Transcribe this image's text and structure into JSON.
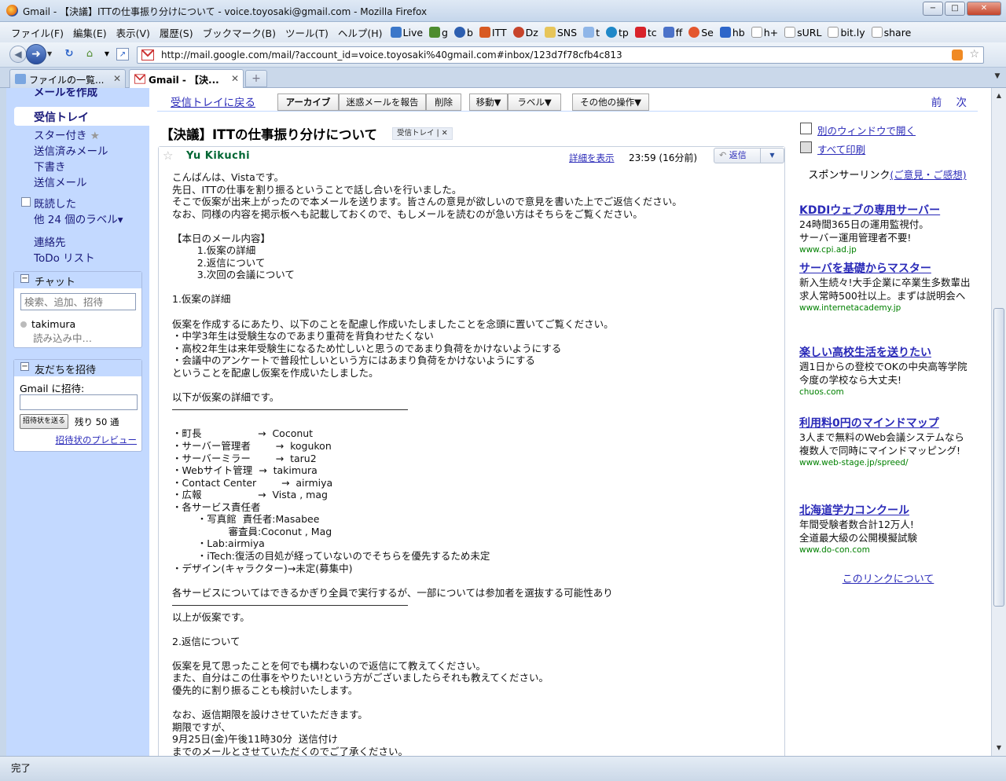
{
  "window": {
    "title": "Gmail - 【決議】ITTの仕事振り分けについて - voice.toyosaki@gmail.com - Mozilla Firefox",
    "min_glyph": "−",
    "max_glyph": "□",
    "close_glyph": "✕"
  },
  "menu": {
    "items": [
      "ファイル(F)",
      "編集(E)",
      "表示(V)",
      "履歴(S)",
      "ブックマーク(B)",
      "ツール(T)",
      "ヘルプ(H)"
    ],
    "bookmarks": [
      "Live",
      "g",
      "b",
      "ITT",
      "Dz",
      "SNS",
      "t",
      "tp",
      "tc",
      "ff",
      "Se",
      "hb",
      "h+",
      "sURL",
      "bit.ly",
      "share"
    ]
  },
  "nav": {
    "url": "http://mail.google.com/mail/?account_id=voice.toyosaki%40gmail.com#inbox/123d7f78cfb4c813"
  },
  "tabs": [
    {
      "label": "ファイルの一覧..."
    },
    {
      "label": "Gmail - 【決..."
    }
  ],
  "colors": {
    "nav_bg": "#c3d9ff",
    "link": "#2a2ab8",
    "sender": "#006633",
    "ad_url": "#008000"
  },
  "gmail": {
    "nav": {
      "compose": "メールを作成",
      "inbox": "受信トレイ",
      "starred": "スター付き",
      "sent": "送信済みメール",
      "drafts": "下書き",
      "scheduled": "送信メール",
      "label_done": "既読した",
      "more_labels": "他 24 個のラベル▾",
      "contacts": "連絡先",
      "todo": "ToDo リスト"
    },
    "chat": {
      "title": "チャット",
      "search_placeholder": "検索、追加、招待",
      "contact_name": "takimura",
      "contact_status": "読み込み中…"
    },
    "invite": {
      "title": "友だちを招待",
      "label": "Gmail に招待:",
      "button": "招待状を送る",
      "remaining": "残り 50 通",
      "preview": "招待状のプレビュー"
    },
    "toolbar": {
      "back": "受信トレイに戻る",
      "archive": "アーカイブ",
      "spam": "迷惑メールを報告",
      "delete": "削除",
      "move": "移動▼",
      "labels": "ラベル▼",
      "more_actions": "その他の操作▼",
      "prev_next": "前 次"
    },
    "message": {
      "subject": "【決議】ITTの仕事振り分けについて",
      "label_chip": "受信トレイ | ✕",
      "sender": "Yu Kikuchi",
      "show_details": "詳細を表示",
      "time": "23:59 (16分前)",
      "reply": "返信",
      "body": "こんばんは、Vistaです。\n先日、ITTの仕事を割り振るということで話し合いを行いました。\nそこで仮案が出来上がったので本メールを送ります。皆さんの意見が欲しいので意見を書いた上でご返信ください。\nなお、同様の内容を掲示板へも記載しておくので、もしメールを読むのが急い方はそちらをご覧ください。\n\n【本日のメール内容】\n        1.仮案の詳細\n        2.返信について\n        3.次回の会議について\n\n1.仮案の詳細\n\n仮案を作成するにあたり、以下のことを配慮し作成いたしましたことを念頭に置いてご覧ください。\n・中学3年生は受験生なのであまり重荷を背負わせたくない\n・高校2年生は来年受験生になるため忙しいと思うのであまり負荷をかけないようにする\n・会議中のアンケートで普段忙しいという方にはあまり負荷をかけないようにする\nということを配慮し仮案を作成いたしました。\n\n以下が仮案の詳細です。\n――――――――――――――――――――――――\n\n・町長                  →  Coconut\n・サーバー管理者        →  kogukon\n・サーバーミラー        →  taru2\n・Webサイト管理  →  takimura\n・Contact Center        →  airmiya\n・広報                  →  Vista , mag\n・各サービス責任者\n        ・写真館  責任者:Masabee\n                  審査員:Coconut , Mag\n        ・Lab:airmiya\n        ・iTech:復活の目処が経っていないのでそちらを優先するため未定\n・デザイン(キャラクター)→未定(募集中)\n\n各サービスについてはできるかぎり全員で実行するが、一部については参加者を選抜する可能性あり\n――――――――――――――――――――――――\n以上が仮案です。\n\n2.返信について\n\n仮案を見て思ったことを何でも構わないので返信にて教えてください。\nまた、自分はこの仕事をやりたい!という方がございましたらそれも教えてください。\n優先的に割り振ることも検討いたします。\n\nなお、返信期限を設けさせていただきます。\n期限ですが、\n9月25日(金)午後11時30分  送信付け\nまでのメールとさせていただくのでご了承ください。"
    },
    "right": {
      "new_window": "別のウィンドウで開く",
      "print_all": "すべて印刷",
      "sponsor_label": "スポンサーリンク",
      "sponsor_feedback": "(ご意見・ご感想)",
      "about_links": "このリンクについて",
      "ads": [
        {
          "title": "KDDIウェブの専用サーバー",
          "text": "24時間365日の運用監視付。\nサーバー運用管理者不要!",
          "url": "www.cpi.ad.jp"
        },
        {
          "title": "サーバを基礎からマスター",
          "text": "新入生続々!大手企業に卒業生多数輩出\n求人常時500社以上。まずは説明会へ",
          "url": "www.internetacademy.jp"
        },
        {
          "title": "楽しい高校生活を送りたい",
          "text": "週1日からの登校でOKの中央高等学院\n今度の学校なら大丈夫!",
          "url": "chuos.com"
        },
        {
          "title": "利用料0円のマインドマップ",
          "text": "3人まで無料のWeb会議システムなら\n複数人で同時にマインドマッピング!",
          "url": "www.web-stage.jp/spreed/"
        },
        {
          "title": "北海道学力コンクール",
          "text": "年間受験者数合計12万人!\n全道最大級の公開模擬試験",
          "url": "www.do-con.com"
        }
      ]
    }
  },
  "status": {
    "text": "完了"
  }
}
